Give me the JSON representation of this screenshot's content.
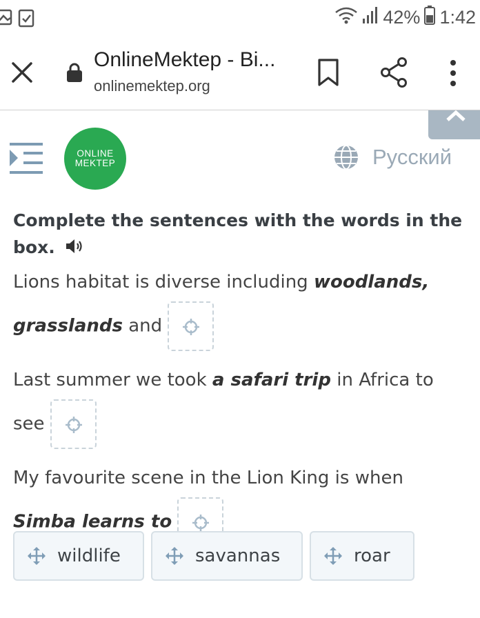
{
  "status_bar": {
    "battery": "42%",
    "time": "1:42",
    "icons": [
      "image-icon",
      "clipboard-check-icon",
      "wifi-icon",
      "signal-icon",
      "battery-icon"
    ]
  },
  "browser": {
    "tab_title": "OnlineMektep - Bi...",
    "domain": "onlinemektep.org"
  },
  "site": {
    "logo_line1": "ONLINE",
    "logo_line2": "MEKTEP",
    "language": "Русский",
    "brand_color": "#2aa952"
  },
  "exercise": {
    "instruction": "Complete the sentences with the words in the box.",
    "sentences": [
      {
        "text_before": "Lions habitat is diverse including ",
        "emphasis": "woodlands, grasslands",
        "text_after": " and"
      },
      {
        "text_before": "Last summer we took ",
        "emphasis": "a safari trip",
        "text_after": " in Africa to see"
      },
      {
        "text_before": "My favourite scene in the Lion King is when ",
        "emphasis": "Simba learns to",
        "text_after": ""
      }
    ],
    "options": [
      "wildlife",
      "savannas",
      "roar"
    ]
  }
}
